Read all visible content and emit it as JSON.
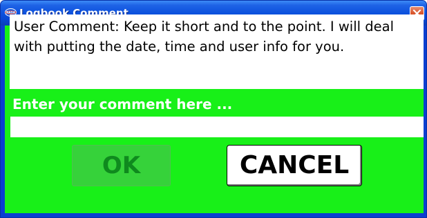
{
  "window": {
    "title": "Logbook Comment",
    "title_color": "#ffffff",
    "titlebar_color": "#0a4fdc",
    "close_icon": "close-icon",
    "app_icon": "app-logo-icon",
    "app_icon_text": "NASA"
  },
  "comment": {
    "text": "User Comment: Keep it short and to the point. I will deal with putting the date, time and user info for you."
  },
  "entry": {
    "label": "Enter your comment here ...",
    "value": "",
    "placeholder": ""
  },
  "buttons": {
    "ok_label": "OK",
    "ok_state": "disabled",
    "cancel_label": "CANCEL"
  },
  "colors": {
    "background": "#18f018",
    "ok_background": "#36d23a",
    "ok_text": "#0f8a1e",
    "cancel_background": "#ffffff",
    "cancel_text": "#000000"
  }
}
